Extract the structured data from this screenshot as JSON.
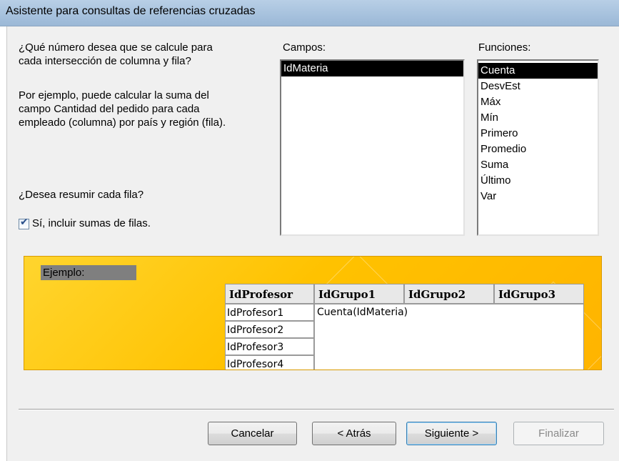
{
  "window": {
    "title": "Asistente para consultas de referencias cruzadas"
  },
  "instructions": {
    "question_line1": "¿Qué número desea que se calcule para",
    "question_line2": "cada intersección de columna y fila?",
    "example_line1": "Por ejemplo, puede calcular la suma del",
    "example_line2": "campo Cantidad del pedido para cada",
    "example_line3": "empleado (columna) por país y región (fila).",
    "summary_question": "¿Desea resumir cada fila?",
    "summary_checkbox_label": "Sí, incluir sumas de filas.",
    "summary_checked": true
  },
  "fields": {
    "label": "Campos:",
    "items": [
      "IdMateria"
    ],
    "selected": "IdMateria"
  },
  "functions": {
    "label": "Funciones:",
    "items": [
      "Cuenta",
      "DesvEst",
      "Máx",
      "Mín",
      "Primero",
      "Promedio",
      "Suma",
      "Último",
      "Var"
    ],
    "selected": "Cuenta"
  },
  "example": {
    "label": "Ejemplo:",
    "row_header": "IdProfesor",
    "columns": [
      "IdGrupo1",
      "IdGrupo2",
      "IdGrupo3"
    ],
    "rows": [
      "IdProfesor1",
      "IdProfesor2",
      "IdProfesor3",
      "IdProfesor4"
    ],
    "cell": "Cuenta(IdMateria)"
  },
  "buttons": {
    "cancel": "Cancelar",
    "back": "< Atrás",
    "next": "Siguiente >",
    "finish": "Finalizar"
  },
  "colors": {
    "accent_panel": "#ffc200",
    "selection": "#000000"
  }
}
